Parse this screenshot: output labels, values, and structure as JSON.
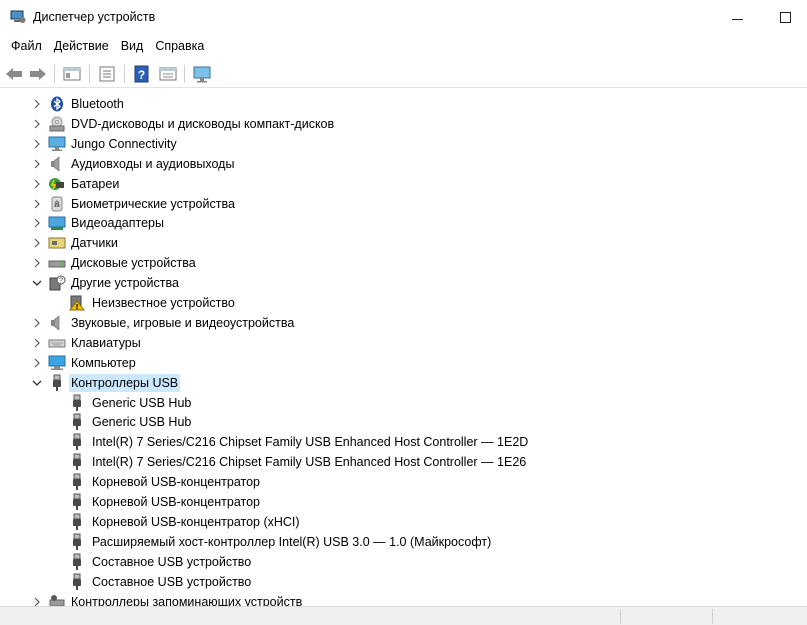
{
  "window": {
    "title": "Диспетчер устройств",
    "minimize_glyph": "—",
    "maximize_glyph": "☐"
  },
  "menu": {
    "items": [
      "Файл",
      "Действие",
      "Вид",
      "Справка"
    ]
  },
  "toolbar": {
    "buttons": [
      "back-icon",
      "forward-icon",
      "show-hide-console-tree-icon",
      "properties-icon",
      "help-icon",
      "view-icon",
      "monitor-icon"
    ]
  },
  "tree": {
    "items": [
      {
        "label": "Bluetooth",
        "icon": "bluetooth-icon",
        "level": 1,
        "state": "collapsed"
      },
      {
        "label": "DVD-дисководы и дисководы компакт-дисков",
        "icon": "dvd-drive-icon",
        "level": 1,
        "state": "collapsed"
      },
      {
        "label": "Jungo Connectivity",
        "icon": "monitor-icon",
        "level": 1,
        "state": "collapsed"
      },
      {
        "label": "Аудиовходы и аудиовыходы",
        "icon": "speaker-icon",
        "level": 1,
        "state": "collapsed"
      },
      {
        "label": "Батареи",
        "icon": "battery-icon",
        "level": 1,
        "state": "collapsed"
      },
      {
        "label": "Биометрические устройства",
        "icon": "fingerprint-icon",
        "level": 1,
        "state": "collapsed"
      },
      {
        "label": "Видеоадаптеры",
        "icon": "display-adapter-icon",
        "level": 1,
        "state": "collapsed"
      },
      {
        "label": "Датчики",
        "icon": "sensor-icon",
        "level": 1,
        "state": "collapsed"
      },
      {
        "label": "Дисковые устройства",
        "icon": "disk-drive-icon",
        "level": 1,
        "state": "collapsed"
      },
      {
        "label": "Другие устройства",
        "icon": "other-devices-icon",
        "level": 1,
        "state": "expanded"
      },
      {
        "label": "Неизвестное устройство",
        "icon": "unknown-device-warning-icon",
        "level": 2,
        "state": "leaf"
      },
      {
        "label": "Звуковые, игровые и видеоустройства",
        "icon": "speaker-icon",
        "level": 1,
        "state": "collapsed"
      },
      {
        "label": "Клавиатуры",
        "icon": "keyboard-icon",
        "level": 1,
        "state": "collapsed"
      },
      {
        "label": "Компьютер",
        "icon": "computer-icon",
        "level": 1,
        "state": "collapsed"
      },
      {
        "label": "Контроллеры USB",
        "icon": "usb-plug-icon",
        "level": 1,
        "state": "expanded",
        "selected": true
      },
      {
        "label": "Generic USB Hub",
        "icon": "usb-plug-icon",
        "level": 2,
        "state": "leaf"
      },
      {
        "label": "Generic USB Hub",
        "icon": "usb-plug-icon",
        "level": 2,
        "state": "leaf"
      },
      {
        "label": "Intel(R) 7 Series/C216 Chipset Family USB Enhanced Host Controller — 1E2D",
        "icon": "usb-plug-icon",
        "level": 2,
        "state": "leaf"
      },
      {
        "label": "Intel(R) 7 Series/C216 Chipset Family USB Enhanced Host Controller — 1E26",
        "icon": "usb-plug-icon",
        "level": 2,
        "state": "leaf"
      },
      {
        "label": "Корневой USB-концентратор",
        "icon": "usb-plug-icon",
        "level": 2,
        "state": "leaf"
      },
      {
        "label": "Корневой USB-концентратор",
        "icon": "usb-plug-icon",
        "level": 2,
        "state": "leaf"
      },
      {
        "label": "Корневой USB-концентратор (xHCI)",
        "icon": "usb-plug-icon",
        "level": 2,
        "state": "leaf"
      },
      {
        "label": "Расширяемый хост-контроллер Intel(R) USB 3.0 — 1.0 (Майкрософт)",
        "icon": "usb-plug-icon",
        "level": 2,
        "state": "leaf"
      },
      {
        "label": "Составное USB устройство",
        "icon": "usb-plug-icon",
        "level": 2,
        "state": "leaf"
      },
      {
        "label": "Составное USB устройство",
        "icon": "usb-plug-icon",
        "level": 2,
        "state": "leaf"
      },
      {
        "label": "Контроллеры запоминающих устройств",
        "icon": "storage-controller-icon",
        "level": 1,
        "state": "collapsed"
      }
    ]
  },
  "colors": {
    "selection": "#cce8ff",
    "chevron": "#5a5a5a"
  }
}
